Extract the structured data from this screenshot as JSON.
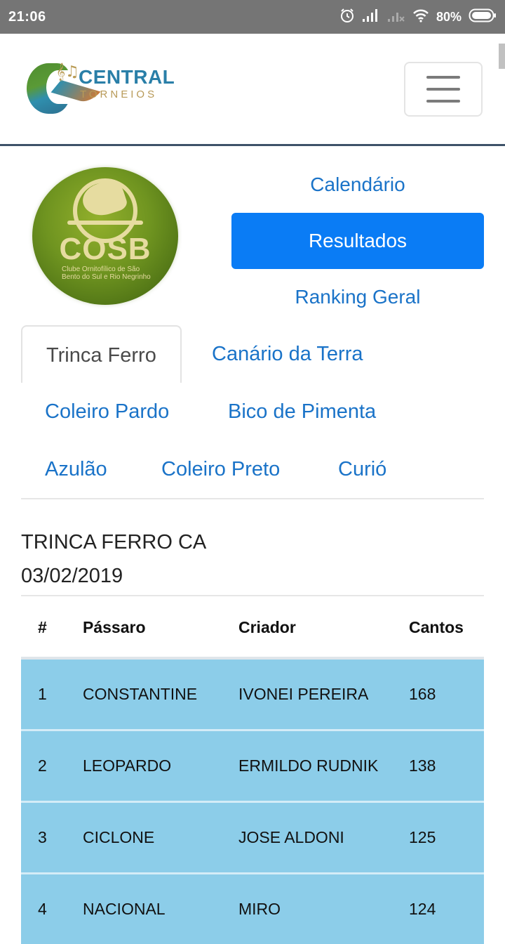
{
  "status_bar": {
    "time": "21:06",
    "battery_percent": "80%",
    "icons": [
      "alarm-icon",
      "signal-icon",
      "signal-no-sim-icon",
      "wifi-icon",
      "battery-icon"
    ]
  },
  "header": {
    "logo": {
      "brand_top": "CENTRAL",
      "brand_bottom": "TORNEIOS",
      "notes_glyph": "𝄞♫"
    },
    "menu_icon": "hamburger-menu-icon"
  },
  "club": {
    "acronym": "COSB",
    "subtitle": "Clube Ornitofílico de São Bento do Sul e Rio Negrinho"
  },
  "nav": {
    "items": [
      {
        "label": "Calendário",
        "active": false
      },
      {
        "label": "Resultados",
        "active": true
      },
      {
        "label": "Ranking Geral",
        "active": false
      }
    ]
  },
  "tabs": [
    {
      "label": "Trinca Ferro",
      "active": true
    },
    {
      "label": "Canário da Terra",
      "active": false
    },
    {
      "label": "Coleiro Pardo",
      "active": false
    },
    {
      "label": "Bico de Pimenta",
      "active": false
    },
    {
      "label": "Azulão",
      "active": false
    },
    {
      "label": "Coleiro Preto",
      "active": false
    },
    {
      "label": "Curió",
      "active": false
    }
  ],
  "results": {
    "title": "TRINCA FERRO CA",
    "date": "03/02/2019",
    "columns": [
      "#",
      "Pássaro",
      "Criador",
      "Cantos"
    ],
    "rows": [
      {
        "pos": "1",
        "bird": "CONSTANTINE",
        "breeder": "IVONEI PEREIRA",
        "songs": "168"
      },
      {
        "pos": "2",
        "bird": "LEOPARDO",
        "breeder": "ERMILDO RUDNIK",
        "songs": "138"
      },
      {
        "pos": "3",
        "bird": "CICLONE",
        "breeder": "JOSE ALDONI",
        "songs": "125"
      },
      {
        "pos": "4",
        "bird": "NACIONAL",
        "breeder": "MIRO",
        "songs": "124"
      }
    ]
  },
  "colors": {
    "accent": "#0a7cf5",
    "link": "#1a73c8",
    "row_highlight": "#8ccde9",
    "header_border": "#3e5269",
    "status_bar": "#757575"
  }
}
